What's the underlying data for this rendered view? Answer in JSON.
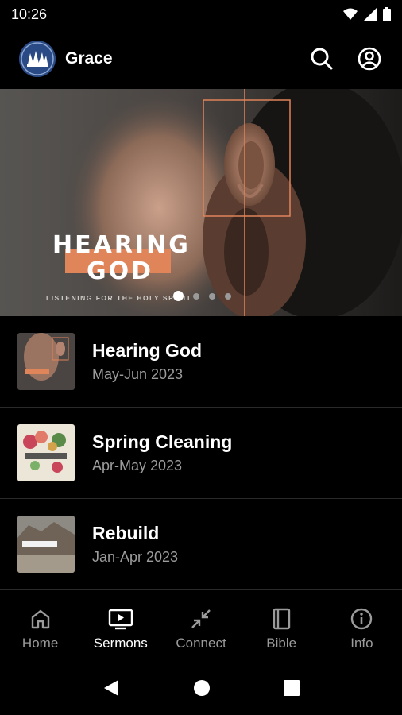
{
  "status": {
    "time": "10:26"
  },
  "app": {
    "title": "Grace"
  },
  "hero": {
    "title_line1": "HEARING",
    "title_line2": "GOD",
    "tagline": "LISTENING FOR THE HOLY SPIRIT",
    "slides": 4,
    "active_slide": 1
  },
  "series": [
    {
      "title": "Hearing God",
      "dates": "May-Jun 2023",
      "thumb_text": "HEARING GOD"
    },
    {
      "title": "Spring Cleaning",
      "dates": "Apr-May 2023",
      "thumb_text": "SPRING"
    },
    {
      "title": "Rebuild",
      "dates": "Jan-Apr 2023",
      "thumb_text": "REBUILD."
    }
  ],
  "nav": [
    {
      "label": "Home",
      "icon": "home-icon",
      "active": false
    },
    {
      "label": "Sermons",
      "icon": "tv-play-icon",
      "active": true
    },
    {
      "label": "Connect",
      "icon": "connect-arrows-icon",
      "active": false
    },
    {
      "label": "Bible",
      "icon": "book-icon",
      "active": false
    },
    {
      "label": "Info",
      "icon": "info-icon",
      "active": false
    }
  ],
  "colors": {
    "accent": "#e0845a",
    "muted": "#9b9b9b",
    "logo_bg": "#2a4a86"
  }
}
